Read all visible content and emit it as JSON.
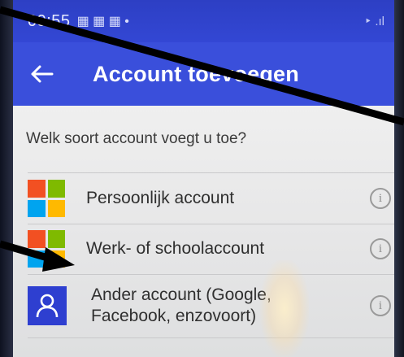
{
  "statusbar": {
    "time": "09:55",
    "notification_icons": "▦ ▦ ▦ •",
    "signal_text": "‣ .ıl"
  },
  "appbar": {
    "back_icon": "arrow-left-icon",
    "title": "Account toevoegen"
  },
  "question": "Welk soort account voegt u toe?",
  "accounts": [
    {
      "label": "Persoonlijk account",
      "icon": "microsoft-logo-icon",
      "info_icon": "info-icon"
    },
    {
      "label": "Werk- of schoolaccount",
      "icon": "microsoft-logo-icon",
      "info_icon": "info-icon"
    },
    {
      "label_line1": "Ander account (Google,",
      "label_line2": "Facebook, enzovoort)",
      "icon": "person-icon",
      "info_icon": "info-icon"
    }
  ],
  "colors": {
    "appbar": "#3a4fdb",
    "ms_red": "#f25022",
    "ms_green": "#7fba00",
    "ms_blue": "#00a4ef",
    "ms_yellow": "#ffb900",
    "annotation_line": "#000000"
  }
}
